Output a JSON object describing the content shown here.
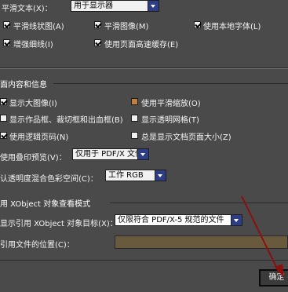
{
  "display": {
    "smooth_text_label": "平滑文本(X)：",
    "smooth_text_value": "用于显示器",
    "smooth_line_art": "平滑线状图(A)",
    "smooth_images": "平滑图像(M)",
    "use_local_fonts": "使用本地字体(L)",
    "enhance_thin_lines": "增强细线(I)",
    "use_page_cache": "使用页面高速缓存(E)"
  },
  "page_content": {
    "title": "面内容和信息",
    "show_large_images": "显示大图像(I)",
    "use_smooth_zoom": "使用平滑缩放(O)",
    "show_art_trim_bleed": "显示作品框、裁切框和出血框(B)",
    "show_transparency_grid": "显示透明网格(T)",
    "use_logical_page_numbers": "使用逻辑页码(N)",
    "always_show_doc_page_size": "总是显示文档页面大小(Z)",
    "overprint_preview_label": "使用叠印预览(V)：",
    "overprint_preview_value": "仅用于 PDF/X 文件",
    "default_blend_space_label": "认透明度混合色彩空间(C)：",
    "default_blend_space_value": "工作 RGB"
  },
  "xobject": {
    "title": "用 XObject 对象查看模式",
    "show_reference_label": "显示引用 XObject 对象目标(X)：",
    "show_reference_value": "仅限符合 PDF/X-5 规范的文件",
    "referenced_location_label": "引用文件的位置(C)："
  },
  "footer": {
    "ok_button": "确定"
  },
  "colors": {
    "background": "#4a4a4a",
    "select_arrow": "#2d3d86",
    "annotation_arrow": "#8a1010"
  },
  "icons": [
    "checkbox-icon",
    "dropdown-arrow-icon",
    "arrow-pointer-icon"
  ]
}
